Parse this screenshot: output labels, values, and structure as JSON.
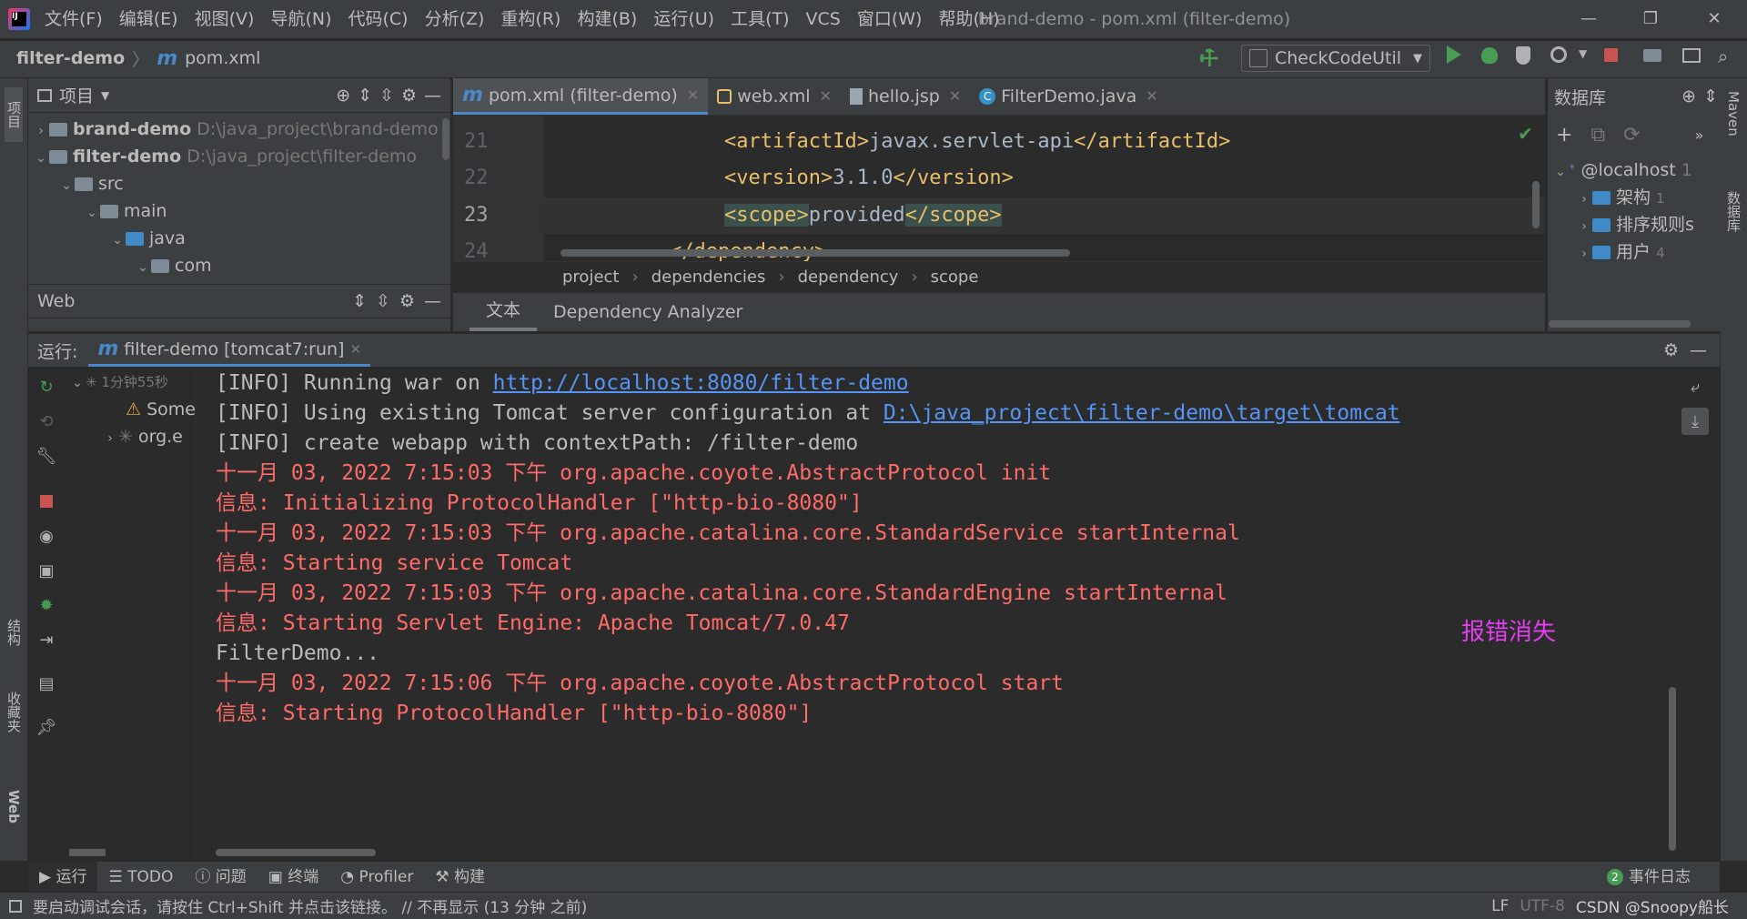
{
  "menu": [
    "文件(F)",
    "编辑(E)",
    "视图(V)",
    "导航(N)",
    "代码(C)",
    "分析(Z)",
    "重构(R)",
    "构建(B)",
    "运行(U)",
    "工具(T)",
    "VCS",
    "窗口(W)",
    "帮助(H)"
  ],
  "window_title": "brand-demo - pom.xml (filter-demo)",
  "navbar": {
    "project": "filter-demo",
    "file": "pom.xml",
    "run_config": "CheckCodeUtil"
  },
  "left_stripe": {
    "top": "项目",
    "structure": "结构",
    "favorites": "收藏夹",
    "web": "Web"
  },
  "right_stripe": {
    "maven": "Maven",
    "database": "数据库"
  },
  "project_panel": {
    "title": "项目",
    "items": [
      {
        "name": "brand-demo",
        "path": "D:\\java_project\\brand-demo"
      },
      {
        "name": "filter-demo",
        "path": "D:\\java_project\\filter-demo"
      },
      {
        "name": "src"
      },
      {
        "name": "main"
      },
      {
        "name": "java"
      },
      {
        "name": "com"
      }
    ]
  },
  "web_panel": {
    "title": "Web"
  },
  "editor": {
    "tabs": [
      {
        "label": "pom.xml (filter-demo)"
      },
      {
        "label": "web.xml"
      },
      {
        "label": "hello.jsp"
      },
      {
        "label": "FilterDemo.java"
      }
    ],
    "line_numbers": [
      "21",
      "22",
      "23",
      "24"
    ],
    "lines": {
      "l21_open": "<artifactId>",
      "l21_text": "javax.servlet-api",
      "l21_close": "</artifactId>",
      "l22_open": "<version>",
      "l22_text": "3.1.0",
      "l22_close": "</version>",
      "l23_open": "<scope>",
      "l23_text": "provided",
      "l23_close": "</scope>",
      "l24": "</dependency>"
    },
    "breadcrumbs": [
      "project",
      "dependencies",
      "dependency",
      "scope"
    ],
    "bottom_tabs": [
      "文本",
      "Dependency Analyzer"
    ]
  },
  "database_panel": {
    "title": "数据库",
    "host": "@localhost",
    "host_count": "1",
    "items": [
      {
        "label": "架构",
        "count": "1"
      },
      {
        "label": "排序规则",
        "count": "s"
      },
      {
        "label": "用户",
        "count": "4"
      }
    ]
  },
  "run_panel": {
    "label": "运行:",
    "tab": "filter-demo [tomcat7:run]",
    "tree": {
      "root_time": "1分钟55秒",
      "warning": "Some",
      "org": "org.e"
    },
    "console": {
      "l1_text": "[INFO] Running war on ",
      "l1_link": "http://localhost:8080/filter-demo",
      "l2_text": "[INFO] Using existing Tomcat server configuration at ",
      "l2_link": "D:\\java_project\\filter-demo\\target\\tomcat",
      "l3": "[INFO] create webapp with contextPath: /filter-demo",
      "l4": "十一月 03, 2022 7:15:03 下午 org.apache.coyote.AbstractProtocol init",
      "l5": "信息: Initializing ProtocolHandler [\"http-bio-8080\"]",
      "l6": "十一月 03, 2022 7:15:03 下午 org.apache.catalina.core.StandardService startInternal",
      "l7": "信息: Starting service Tomcat",
      "l8": "十一月 03, 2022 7:15:03 下午 org.apache.catalina.core.StandardEngine startInternal",
      "l9": "信息: Starting Servlet Engine: Apache Tomcat/7.0.47",
      "l10": "FilterDemo...",
      "l11": "十一月 03, 2022 7:15:06 下午 org.apache.coyote.AbstractProtocol start",
      "l12": "信息: Starting ProtocolHandler [\"http-bio-8080\"]"
    },
    "annotation": "报错消失"
  },
  "bottom_toolbar": {
    "items": [
      "运行",
      "TODO",
      "问题",
      "终端",
      "Profiler",
      "构建"
    ],
    "event_log_count": "2",
    "event_log": "事件日志"
  },
  "status_bar": {
    "message": "要启动调试会话，请按住 Ctrl+Shift 并点击该链接。 // 不再显示 (13 分钟 之前)",
    "line_sep": "LF",
    "encoding": "UTF-8",
    "watermark": "CSDN @Snoopy船长"
  },
  "colors": {
    "accent": "#4a88c7",
    "error_text": "#ff6b68",
    "link": "#5694f6",
    "annotation": "#e33ef0",
    "run_green": "#499c54",
    "stop_red": "#c75450"
  }
}
